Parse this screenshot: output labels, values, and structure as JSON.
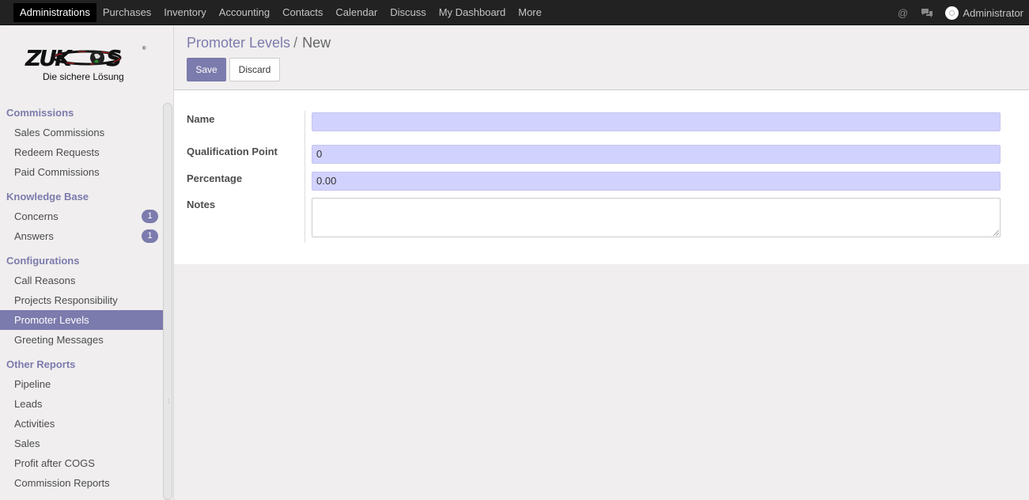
{
  "navbar": {
    "items": [
      "Administrations",
      "Purchases",
      "Inventory",
      "Accounting",
      "Contacts",
      "Calendar",
      "Discuss",
      "My Dashboard",
      "More"
    ],
    "active_item": "Administrations",
    "user": "Administrator",
    "icons": [
      "at-icon",
      "chat-icon",
      "avatar"
    ]
  },
  "logo": {
    "brand": "ZUKOS",
    "tagline": "Die sichere Lösung"
  },
  "sidebar": {
    "sections": [
      {
        "title": "Commissions",
        "items": [
          {
            "label": "Sales Commissions"
          },
          {
            "label": "Redeem Requests"
          },
          {
            "label": "Paid Commissions"
          }
        ]
      },
      {
        "title": "Knowledge Base",
        "items": [
          {
            "label": "Concerns",
            "badge": "1"
          },
          {
            "label": "Answers",
            "badge": "1"
          }
        ]
      },
      {
        "title": "Configurations",
        "items": [
          {
            "label": "Call Reasons"
          },
          {
            "label": "Projects Responsibility"
          },
          {
            "label": "Promoter Levels",
            "active": true
          },
          {
            "label": "Greeting Messages"
          }
        ]
      },
      {
        "title": "Other Reports",
        "items": [
          {
            "label": "Pipeline"
          },
          {
            "label": "Leads"
          },
          {
            "label": "Activities"
          },
          {
            "label": "Sales"
          },
          {
            "label": "Profit after COGS"
          },
          {
            "label": "Commission Reports"
          }
        ]
      }
    ]
  },
  "breadcrumb": {
    "parent": "Promoter Levels",
    "separator": "/",
    "current": "New"
  },
  "buttons": {
    "save": "Save",
    "discard": "Discard"
  },
  "form": {
    "name_label": "Name",
    "name_value": "",
    "qualification_label": "Qualification Point",
    "qualification_value": "0",
    "percentage_label": "Percentage",
    "percentage_value": "0.00",
    "notes_label": "Notes",
    "notes_value": ""
  },
  "colors": {
    "accent": "#7c7bad",
    "navbar": "#222222",
    "required_field": "#d2d2ff"
  }
}
